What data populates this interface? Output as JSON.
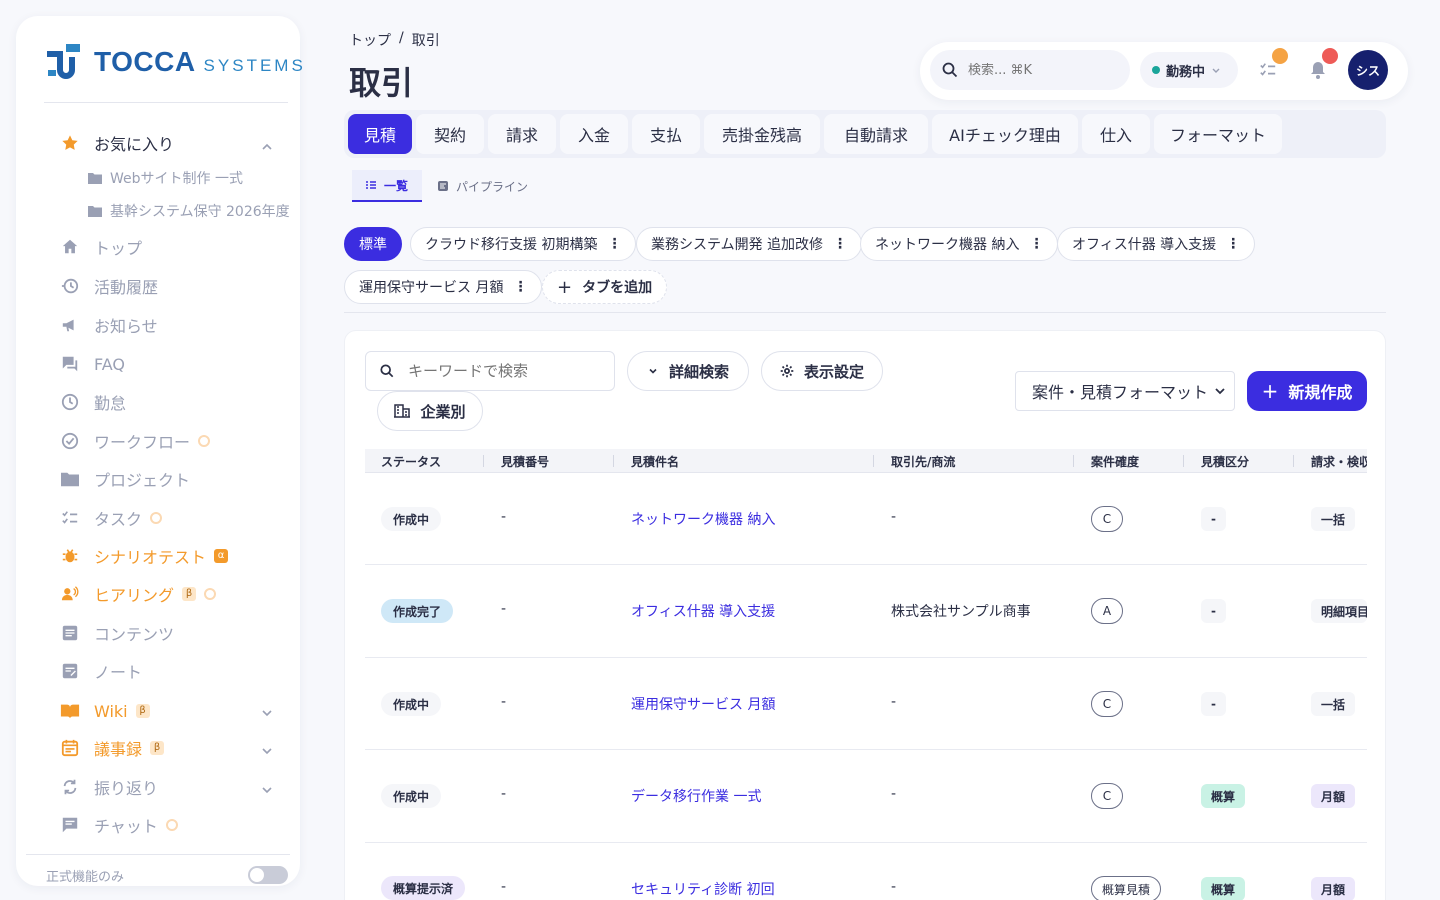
{
  "brand": {
    "name": "TOCCA",
    "sub": "SYSTEMS"
  },
  "sidebar": {
    "favorites": {
      "label": "お気に入り",
      "items": [
        "Webサイト制作 一式",
        "基幹システム保守 2026年度"
      ]
    },
    "items": [
      {
        "label": "トップ",
        "icon": "home-icon"
      },
      {
        "label": "活動履歴",
        "icon": "history-icon"
      },
      {
        "label": "お知らせ",
        "icon": "megaphone-icon"
      },
      {
        "label": "FAQ",
        "icon": "chat-icon"
      },
      {
        "label": "勤怠",
        "icon": "clock-icon"
      },
      {
        "label": "ワークフロー",
        "icon": "check-circle-icon"
      },
      {
        "label": "プロジェクト",
        "icon": "folder-icon"
      },
      {
        "label": "タスク",
        "icon": "checklist-icon"
      },
      {
        "label": "シナリオテスト",
        "icon": "bug-icon",
        "badge": "α"
      },
      {
        "label": "ヒアリング",
        "icon": "people-icon",
        "badge": "β"
      },
      {
        "label": "コンテンツ",
        "icon": "article-icon"
      },
      {
        "label": "ノート",
        "icon": "note-icon"
      },
      {
        "label": "Wiki",
        "icon": "book-icon",
        "badge": "β"
      },
      {
        "label": "議事録",
        "icon": "calendar-icon",
        "badge": "β"
      },
      {
        "label": "振り返り",
        "icon": "refresh-icon"
      },
      {
        "label": "チャット",
        "icon": "message-icon"
      }
    ],
    "footer": {
      "label": "正式機能のみ"
    }
  },
  "header": {
    "breadcrumb": [
      "トップ",
      "/",
      "取引"
    ],
    "title": "取引",
    "search_placeholder": "検索... ⌘K",
    "status": "勤務中",
    "avatar": "シス"
  },
  "tabs": [
    "見積",
    "契約",
    "請求",
    "入金",
    "支払",
    "売掛金残高",
    "自動請求",
    "AIチェック理由",
    "仕入",
    "フォーマット"
  ],
  "view_tabs": [
    "一覧",
    "パイプライン"
  ],
  "filters": {
    "chips": [
      "標準",
      "クラウド移行支援 初期構築",
      "業務システム開発 追加改修",
      "ネットワーク機器 納入",
      "オフィス什器 導入支援",
      "運用保守サービス 月額"
    ],
    "add_label": "タブを追加"
  },
  "toolbar": {
    "keyword_placeholder": "キーワードで検索",
    "advanced": "詳細検索",
    "display": "表示設定",
    "by_company": "企業別",
    "format": "案件・見積フォーマット",
    "create": "新規作成"
  },
  "table": {
    "columns": [
      "ステータス",
      "見積番号",
      "見積件名",
      "取引先/商流",
      "案件確度",
      "見積区分",
      "請求・検収"
    ],
    "rows": [
      {
        "status": "作成中",
        "number": "-",
        "name": "ネットワーク機器 納入",
        "partner": "-",
        "certainty": "C",
        "category": "-",
        "billing": "一括"
      },
      {
        "status": "作成完了",
        "number": "-",
        "name": "オフィス什器 導入支援",
        "partner": "株式会社サンプル商事",
        "certainty": "A",
        "category": "-",
        "billing": "明細項目"
      },
      {
        "status": "作成中",
        "number": "-",
        "name": "運用保守サービス 月額",
        "partner": "-",
        "certainty": "C",
        "category": "-",
        "billing": "一括"
      },
      {
        "status": "作成中",
        "number": "-",
        "name": "データ移行作業 一式",
        "partner": "-",
        "certainty": "C",
        "category": "概算",
        "billing": "月額"
      },
      {
        "status": "概算提示済",
        "number": "-",
        "name": "セキュリティ診断 初回",
        "partner": "-",
        "certainty": "概算見積",
        "category": "概算",
        "billing": "月額"
      }
    ]
  },
  "colors": {
    "accent": "#3b2de0",
    "brand": "#1f5fa8",
    "orange": "#f39a2b"
  }
}
